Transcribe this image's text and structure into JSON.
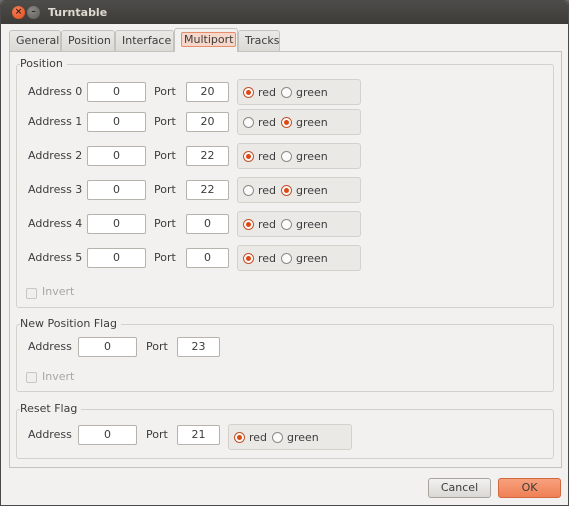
{
  "window": {
    "title": "Turntable"
  },
  "tabs": [
    {
      "label": "General",
      "active": false
    },
    {
      "label": "Position",
      "active": false
    },
    {
      "label": "Interface",
      "active": false
    },
    {
      "label": "Multiport",
      "active": true
    },
    {
      "label": "Tracks",
      "active": false
    }
  ],
  "position_group": {
    "title": "Position",
    "address_prefix": "Address",
    "port_label": "Port",
    "red_label": "red",
    "green_label": "green",
    "rows": [
      {
        "label": "Address 0",
        "address": "0",
        "port": "20",
        "selected": "red"
      },
      {
        "label": "Address 1",
        "address": "0",
        "port": "20",
        "selected": "green"
      },
      {
        "label": "Address 2",
        "address": "0",
        "port": "22",
        "selected": "red"
      },
      {
        "label": "Address 3",
        "address": "0",
        "port": "22",
        "selected": "green"
      },
      {
        "label": "Address 4",
        "address": "0",
        "port": "0",
        "selected": "red"
      },
      {
        "label": "Address 5",
        "address": "0",
        "port": "0",
        "selected": "red"
      }
    ],
    "invert_label": "Invert",
    "invert_checked": false
  },
  "new_position_flag": {
    "title": "New Position Flag",
    "address_label": "Address",
    "address": "0",
    "port_label": "Port",
    "port": "23",
    "invert_label": "Invert",
    "invert_checked": false
  },
  "reset_flag": {
    "title": "Reset Flag",
    "address_label": "Address",
    "address": "0",
    "port_label": "Port",
    "port": "21",
    "red_label": "red",
    "green_label": "green",
    "selected": "red"
  },
  "buttons": {
    "cancel": "Cancel",
    "ok": "OK"
  },
  "colors": {
    "accent": "#dd4814",
    "titlebar": "#3c3b37",
    "ok_button": "#ef8055"
  },
  "icons": {
    "close": "close-icon",
    "minimize": "minimize-icon"
  }
}
